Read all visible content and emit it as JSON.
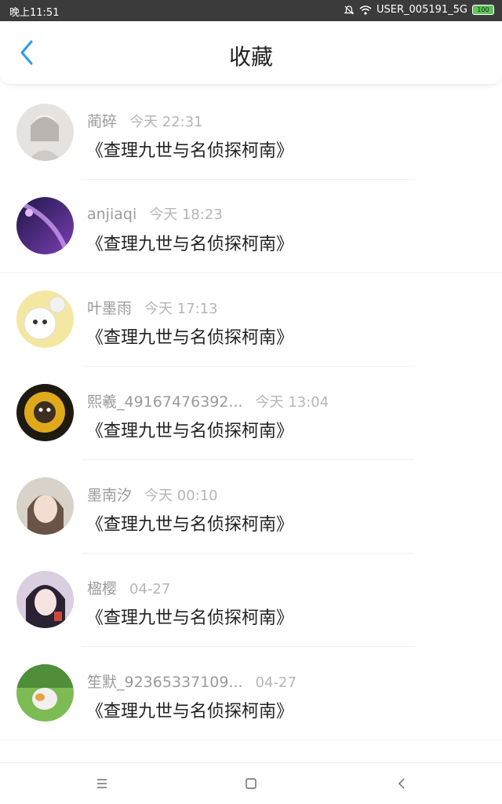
{
  "status_bar": {
    "time": "晚上11:51",
    "network": "USER_005191_5G",
    "battery": "100",
    "icons": [
      "mute-icon",
      "wifi-icon",
      "battery-icon"
    ]
  },
  "header": {
    "title": "收藏",
    "back_icon": "back-icon"
  },
  "items": [
    {
      "user": "蔺碎",
      "time": "今天 22:31",
      "title": "《查理九世与名侦探柯南》"
    },
    {
      "user": "anjiaqi",
      "time": "今天 18:23",
      "title": "《查理九世与名侦探柯南》"
    },
    {
      "user": "叶墨雨",
      "time": "今天 17:13",
      "title": "《查理九世与名侦探柯南》"
    },
    {
      "user": "熙羲_49167476392...",
      "time": "今天 13:04",
      "title": "《查理九世与名侦探柯南》"
    },
    {
      "user": "墨南汐",
      "time": "今天 00:10",
      "title": "《查理九世与名侦探柯南》"
    },
    {
      "user": "楹樱",
      "time": "04-27",
      "title": "《查理九世与名侦探柯南》"
    },
    {
      "user": "笙默_92365337109...",
      "time": "04-27",
      "title": "《查理九世与名侦探柯南》"
    }
  ],
  "nav": [
    "menu-icon",
    "home-icon",
    "back-nav-icon"
  ],
  "colors": {
    "accent": "#2b9bf0",
    "text": "#222222",
    "meta": "#9b9b9b"
  }
}
